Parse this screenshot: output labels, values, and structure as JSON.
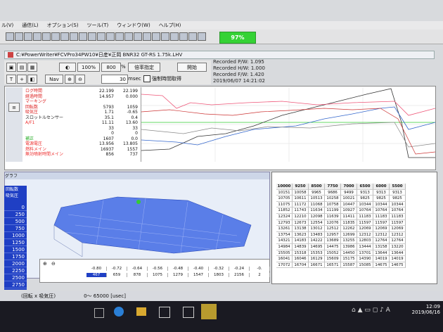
{
  "menu": [
    "ル(V)",
    "通信(L)",
    "オプション(S)",
    "ツール(T)",
    "ウィンドウ(W)",
    "ヘルプ(H)"
  ],
  "progress": "97%",
  "file": {
    "path": "C:¥PowerWriter¥FCVPro34PW10¥日産¥正岡 BNR32 GT-RS 1.75k.LHV"
  },
  "toolbar2": {
    "pct1": "100%",
    "pct2": "800",
    "pct_unit": "%",
    "fixed": "倍率指定",
    "start": "開始",
    "msec_value": "30",
    "msec_unit": "msec",
    "force_label": "強制時間取得",
    "nav": "Nav"
  },
  "recorded": [
    "Recorded P/W: 1.095",
    "Recorded H/W: 1.000",
    "Recorded F/W: 1.420",
    "2019/06/07 14:21:02"
  ],
  "log_labels": [
    {
      "name": "ログ時間",
      "v1": "22.199",
      "v2": "22.199",
      "color": "#d22"
    },
    {
      "name": "経過時間",
      "v1": "14.957",
      "v2": "0.000",
      "color": "#d22"
    },
    {
      "name": "マーキング",
      "v1": "",
      "v2": "",
      "color": "#d22"
    },
    {
      "name": "回転数",
      "v1": "5793",
      "v2": "1059",
      "color": "#d22"
    },
    {
      "name": "吸気圧",
      "v1": "1.71",
      "v2": "-0.65",
      "color": "#d22"
    },
    {
      "name": "スロットルセンサー",
      "v1": "35.1",
      "v2": "0.4",
      "color": "#222"
    },
    {
      "name": "A/F1",
      "v1": "11.11",
      "v2": "13.60",
      "color": "#e33"
    },
    {
      "name": "",
      "v1": "33",
      "v2": "33",
      "color": "#2a2"
    },
    {
      "name": "",
      "v1": "0",
      "v2": "0",
      "color": "#2a2"
    },
    {
      "name": "補正",
      "v1": "1607",
      "v2": "0.0",
      "color": "#2a2"
    },
    {
      "name": "電源電圧",
      "v1": "13.956",
      "v2": "13.805",
      "color": "#e33"
    },
    {
      "name": "燃料メイン",
      "v1": "16937",
      "v2": "1557",
      "color": "#e33"
    },
    {
      "name": "無効噴射時間メイン",
      "v1": "856",
      "v2": "737",
      "color": "#e33"
    }
  ],
  "left_panel": {
    "title": "グラフ",
    "modes": [
      "回転数",
      "吸気圧"
    ]
  },
  "rpm_axis": [
    "0",
    "250",
    "500",
    "750",
    "1000",
    "1250",
    "1500",
    "1750",
    "2000",
    "2250",
    "2500",
    "2750"
  ],
  "axis_bottom": {
    "labels": [
      "-0.80",
      "-0.72",
      "-0.64",
      "-0.56",
      "-0.48",
      "-0.40",
      "-0.32",
      "-0.24",
      "-0."
    ],
    "values": [
      "467",
      "659",
      "878",
      "1075",
      "1279",
      "1547",
      "1803",
      "2156",
      "2"
    ]
  },
  "map": {
    "headers": [
      "10000",
      "9250",
      "8500",
      "7750",
      "7000",
      "6500",
      "6000",
      "5500"
    ],
    "rows": [
      [
        "10151",
        "10058",
        "9965",
        "9686",
        "9499",
        "9313",
        "9313",
        "9313"
      ],
      [
        "10705",
        "10611",
        "10513",
        "10258",
        "10021",
        "9825",
        "9825",
        "9825"
      ],
      [
        "11075",
        "11172",
        "11068",
        "10758",
        "10447",
        "10344",
        "10344",
        "10344"
      ],
      [
        "11852",
        "11743",
        "11634",
        "11199",
        "10927",
        "10764",
        "10764",
        "10764"
      ],
      [
        "12324",
        "12210",
        "12098",
        "11639",
        "11411",
        "11183",
        "11183",
        "11183"
      ],
      [
        "12793",
        "12673",
        "12554",
        "12076",
        "11835",
        "11597",
        "11597",
        "11597"
      ],
      [
        "13261",
        "13138",
        "13012",
        "12512",
        "12262",
        "12069",
        "12069",
        "12069"
      ],
      [
        "13754",
        "13623",
        "13483",
        "12957",
        "12699",
        "12312",
        "12312",
        "12312"
      ],
      [
        "14321",
        "14183",
        "14222",
        "13689",
        "13255",
        "12803",
        "12764",
        "12764"
      ],
      [
        "14984",
        "14839",
        "14695",
        "14475",
        "13986",
        "13444",
        "13158",
        "13220"
      ],
      [
        "15505",
        "15318",
        "15353",
        "15052",
        "14450",
        "13701",
        "13644",
        "13644"
      ],
      [
        "16041",
        "16046",
        "16129",
        "15609",
        "15175",
        "14390",
        "14019",
        "14019"
      ],
      [
        "17072",
        "16704",
        "16671",
        "16571",
        "15587",
        "15085",
        "14675",
        "14675"
      ]
    ]
  },
  "status": {
    "mode": "(回転 x 吸気圧)",
    "range": "0～ 65000 [usec]"
  },
  "clock": {
    "time": "12:09",
    "date": "2019/06/16"
  },
  "colors": {
    "accent_green": "#35d235",
    "selection_blue": "#1f3fc4"
  }
}
